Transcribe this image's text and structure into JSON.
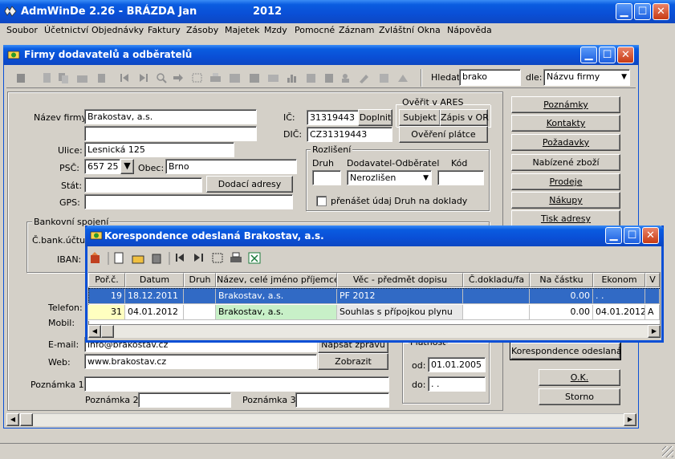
{
  "app": {
    "title": "AdmWinDe 2.26 - BRÁZDA Jan",
    "year": "2012",
    "menu": [
      "Soubor",
      "Účetnictví",
      "Objednávky",
      "Faktury",
      "Zásoby",
      "Majetek",
      "Mzdy",
      "Pomocné",
      "Záznam",
      "Zvláštní",
      "Okna",
      "Nápověda"
    ]
  },
  "firm_window": {
    "title": "Firmy dodavatelů a odběratelů",
    "search": {
      "label": "Hledat:",
      "value": "brako",
      "by_label": "dle:",
      "by_value": "Názvu firmy"
    },
    "fields": {
      "name_label": "Název firmy:",
      "name_value": "Brakostav, a.s.",
      "name2_value": "",
      "street_label": "Ulice:",
      "street_value": "Lesnická 125",
      "psc_label": "PSČ:",
      "psc_value": "657 25",
      "city_label": "Obec:",
      "city_value": "Brno",
      "state_label": "Stát:",
      "state_value": "",
      "gps_label": "GPS:",
      "gps_value": "",
      "ic_label": "IČ:",
      "ic_value": "31319443",
      "dic_label": "DIČ:",
      "dic_value": "CZ31319443",
      "bank_group": "Bankovní spojení",
      "bank_account_label": "Č.bank.účtu:",
      "iban_label": "IBAN:",
      "phone_label": "Telefon:",
      "mobile_label": "Mobil:",
      "email_label": "E-mail:",
      "email_value": "info@brakostav.cz",
      "web_label": "Web:",
      "web_value": "www.brakostav.cz",
      "note1_label": "Poznámka 1:",
      "note1_value": "",
      "note2_label": "Poznámka 2:",
      "note2_value": "",
      "note3_label": "Poznámka 3:",
      "note3_value": ""
    },
    "buttons": {
      "doplnit": "Doplnit",
      "ares_group": "Ověřit v ARES",
      "subjekt": "Subjekt",
      "zapis_or": "Zápis v OR",
      "overeni_platce": "Ověření plátce",
      "dodaci_adresy": "Dodací adresy",
      "napsat_zpravu": "Napsat zprávu",
      "zobrazit": "Zobrazit"
    },
    "rozliseni": {
      "group": "Rozlišení",
      "druh_label": "Druh",
      "druh_value": "",
      "dod_odb_label": "Dodavatel-Odběratel",
      "dod_odb_value": "Nerozlišen",
      "kod_label": "Kód",
      "kod_value": "",
      "prenaset_label": "přenášet údaj Druh na doklady"
    },
    "platnost": {
      "group": "Platnost",
      "od_label": "od:",
      "od_value": "01.01.2005",
      "do_label": "do:",
      "do_value": " .  ."
    },
    "right_buttons": [
      "Poznámky",
      "Kontakty",
      "Požadavky",
      "Nabízené zboží",
      "Prodeje",
      "Nákupy",
      "Tisk adresy"
    ],
    "korespondence_button": "Korespondence odeslaná",
    "ok": "O.K.",
    "storno": "Storno"
  },
  "corr_window": {
    "title": "Korespondence odeslaná Brakostav, a.s.",
    "columns": [
      "Poř.č.",
      "Datum",
      "Druh",
      "Název, celé jméno příjemce",
      "Věc - předmět dopisu",
      "Č.dokladu/fa",
      "Na částku",
      "Ekonom",
      "V"
    ],
    "rows": [
      {
        "no": "19",
        "date": "18.12.2011",
        "druh": "",
        "name": "Brakostav, a.s.",
        "subject": "PF 2012",
        "doc": "",
        "amount": "0.00",
        "ekonom": ". .",
        "v": ""
      },
      {
        "no": "31",
        "date": "04.01.2012",
        "druh": "",
        "name": "Brakostav, a.s.",
        "subject": "Souhlas s přípojkou plynu",
        "doc": "",
        "amount": "0.00",
        "ekonom": "04.01.2012",
        "v": "A"
      }
    ]
  },
  "colors": {
    "title_blue": "#0a4fd6",
    "selected_row": "#316ac5",
    "highlight_yellow": "#ffffc0",
    "highlight_green": "#c8f0c8",
    "desktop": "#d4d0c8"
  }
}
